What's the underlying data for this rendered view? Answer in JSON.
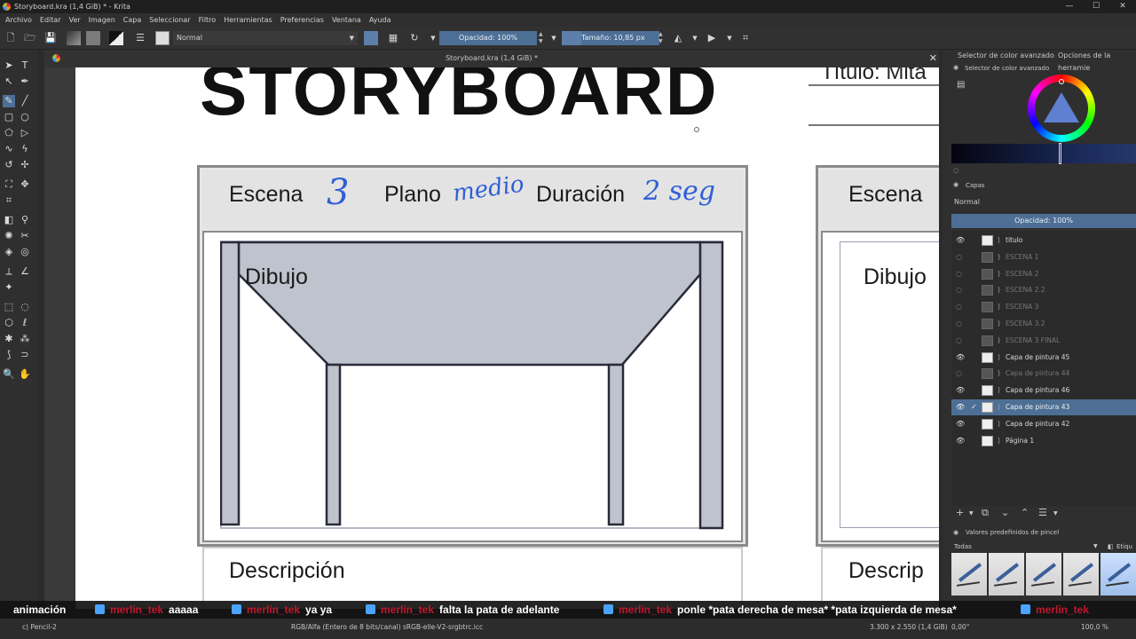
{
  "window": {
    "title": "Storyboard.kra (1,4 GiB) * - Krita",
    "controls": [
      "—",
      "☐",
      "✕"
    ]
  },
  "menu": [
    "Archivo",
    "Editar",
    "Ver",
    "Imagen",
    "Capa",
    "Seleccionar",
    "Filtro",
    "Herramientas",
    "Preferencias",
    "Ventana",
    "Ayuda"
  ],
  "toolbar": {
    "blend_mode": "Normal",
    "opacity": "Opacidad: 100%",
    "size": "Tamaño: 10,85 px"
  },
  "document": {
    "tab_title": "Storyboard.kra (1,4 GiB) *",
    "close_glyph": "✕"
  },
  "canvas": {
    "big_title": "STORYBOARD",
    "titulo_text": "Título: Mita",
    "panel1": {
      "escena_label": "Escena",
      "escena_value": "3",
      "plano_label": "Plano",
      "plano_value": "medio",
      "duracion_label": "Duración",
      "duracion_value": "2 seg",
      "dibujo_label": "Dibujo",
      "descripcion_label": "Descripción"
    },
    "panel2": {
      "escena_label": "Escena",
      "dibujo_label": "Dibujo",
      "descripcion_label": "Descrip"
    }
  },
  "docker": {
    "tabs": [
      "Selector de color avanzado",
      "Opciones de la herramie"
    ],
    "color_selector_title": "Selector de color avanzado",
    "layers_title": "Capas",
    "layers_blend": "Normal",
    "layers_opacity": "Opacidad:  100%",
    "layers": [
      {
        "name": "titulo",
        "visible": true,
        "dim": false,
        "selected": false
      },
      {
        "name": "ESCENA 1",
        "visible": false,
        "dim": true,
        "selected": false
      },
      {
        "name": "ESCENA 2",
        "visible": false,
        "dim": true,
        "selected": false
      },
      {
        "name": "ESCENA 2.2",
        "visible": false,
        "dim": true,
        "selected": false
      },
      {
        "name": "ESCENA 3",
        "visible": false,
        "dim": true,
        "selected": false
      },
      {
        "name": "ESCENA 3.2",
        "visible": false,
        "dim": true,
        "selected": false
      },
      {
        "name": "ESCENA 3 FINAL",
        "visible": false,
        "dim": true,
        "selected": false
      },
      {
        "name": "Capa de pintura 45",
        "visible": true,
        "dim": false,
        "selected": false
      },
      {
        "name": "Capa de pintura 44",
        "visible": false,
        "dim": true,
        "selected": false
      },
      {
        "name": "Capa de pintura 46",
        "visible": true,
        "dim": false,
        "selected": false
      },
      {
        "name": "Capa de pintura 43",
        "visible": true,
        "dim": false,
        "selected": true
      },
      {
        "name": "Capa de pintura 42",
        "visible": true,
        "dim": false,
        "selected": false
      },
      {
        "name": "Página 1",
        "visible": true,
        "dim": false,
        "selected": false
      }
    ],
    "presets_title": "Valores predefinidos de pincel",
    "presets_filter": "Todas",
    "presets_tag": "Etiqu"
  },
  "chat": [
    {
      "user": "",
      "text": "animación"
    },
    {
      "user": "merlin_tek",
      "text": "aaaaa"
    },
    {
      "user": "merlin_tek",
      "text": "ya ya"
    },
    {
      "user": "merlin_tek",
      "text": "falta la pata de adelante"
    },
    {
      "user": "merlin_tek",
      "text": "ponle *pata derecha de mesa* *pata izquierda de mesa*"
    },
    {
      "user": "merlin_tek",
      "text": ""
    }
  ],
  "status": {
    "brush": "c) Pencil-2",
    "color_space": "RGB/Alfa (Entero de 8 bits/canal)  sRGB-elle-V2-srgbtrc.icc",
    "dimensions": "3.300 x 2.550 (1,4 GiB)",
    "rotation": "0,00°",
    "zoom": "100,0 %"
  },
  "colors": {
    "accent": "#4d6f95",
    "handwriting": "#2f5fd6",
    "chat_username": "#c0172d",
    "table_fill": "#bfc3cd"
  }
}
